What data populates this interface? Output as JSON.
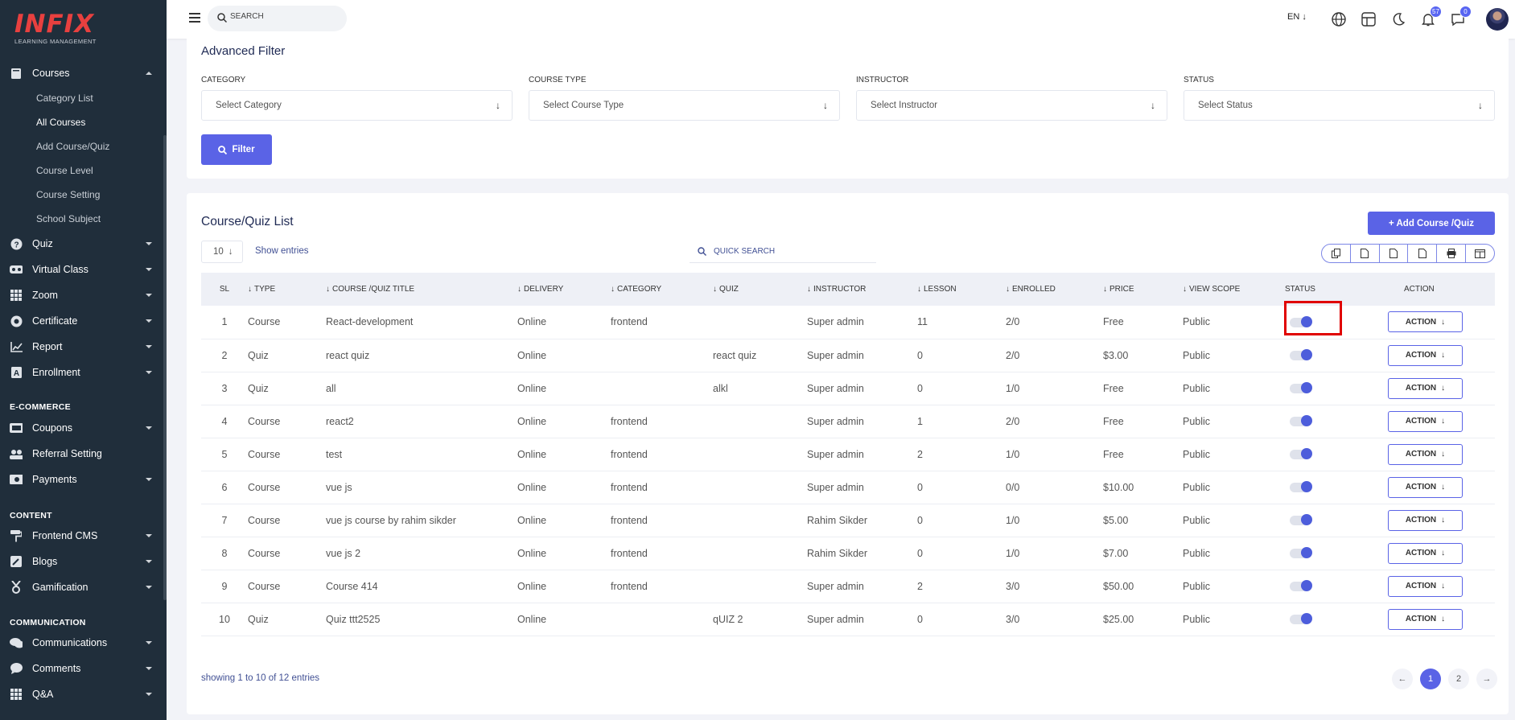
{
  "sidebar": {
    "logo": "INFIX",
    "logo_sub": "LEARNING MANAGEMENT",
    "courses": "Courses",
    "course_sub": [
      "Category List",
      "All Courses",
      "Add Course/Quiz",
      "Course Level",
      "Course Setting",
      "School Subject"
    ],
    "items1": [
      "Quiz",
      "Virtual Class",
      "Zoom",
      "Certificate",
      "Report",
      "Enrollment"
    ],
    "sec_ecom": "E-COMMERCE",
    "items2": [
      "Coupons",
      "Referral Setting",
      "Payments"
    ],
    "sec_content": "CONTENT",
    "items3": [
      "Frontend CMS",
      "Blogs",
      "Gamification"
    ],
    "sec_comm": "COMMUNICATION",
    "items4": [
      "Communications",
      "Comments",
      "Q&A"
    ]
  },
  "topbar": {
    "search_placeholder": "SEARCH",
    "lang": "EN",
    "notif_count": "57",
    "msg_count": "0"
  },
  "filter": {
    "title": "Advanced Filter",
    "fields": [
      {
        "label": "CATEGORY",
        "placeholder": "Select Category"
      },
      {
        "label": "COURSE TYPE",
        "placeholder": "Select Course Type"
      },
      {
        "label": "INSTRUCTOR",
        "placeholder": "Select Instructor"
      },
      {
        "label": "STATUS",
        "placeholder": "Select Status"
      }
    ],
    "button": "Filter"
  },
  "list": {
    "title": "Course/Quiz List",
    "add_button": "+ Add Course /Quiz",
    "per_page": "10",
    "show_entries": "Show entries",
    "quick_search": "QUICK SEARCH",
    "headers": [
      "SL",
      "TYPE",
      "COURSE /QUIZ TITLE",
      "DELIVERY",
      "CATEGORY",
      "QUIZ",
      "INSTRUCTOR",
      "LESSON",
      "ENROLLED",
      "PRICE",
      "VIEW SCOPE",
      "STATUS",
      "ACTION"
    ],
    "action_label": "ACTION",
    "rows": [
      [
        "1",
        "Course",
        "React-development",
        "Online",
        "frontend",
        "",
        "Super admin",
        "11",
        "2/0",
        "Free",
        "Public"
      ],
      [
        "2",
        "Quiz",
        "react quiz",
        "Online",
        "",
        "react quiz",
        "Super admin",
        "0",
        "2/0",
        "$3.00",
        "Public"
      ],
      [
        "3",
        "Quiz",
        "all",
        "Online",
        "",
        "alkl",
        "Super admin",
        "0",
        "1/0",
        "Free",
        "Public"
      ],
      [
        "4",
        "Course",
        "react2",
        "Online",
        "frontend",
        "",
        "Super admin",
        "1",
        "2/0",
        "Free",
        "Public"
      ],
      [
        "5",
        "Course",
        "test",
        "Online",
        "frontend",
        "",
        "Super admin",
        "2",
        "1/0",
        "Free",
        "Public"
      ],
      [
        "6",
        "Course",
        "vue js",
        "Online",
        "frontend",
        "",
        "Super admin",
        "0",
        "0/0",
        "$10.00",
        "Public"
      ],
      [
        "7",
        "Course",
        "vue js course by rahim sikder",
        "Online",
        "frontend",
        "",
        "Rahim Sikder",
        "0",
        "1/0",
        "$5.00",
        "Public"
      ],
      [
        "8",
        "Course",
        "vue js 2",
        "Online",
        "frontend",
        "",
        "Rahim Sikder",
        "0",
        "1/0",
        "$7.00",
        "Public"
      ],
      [
        "9",
        "Course",
        "Course 414",
        "Online",
        "frontend",
        "",
        "Super admin",
        "2",
        "3/0",
        "$50.00",
        "Public"
      ],
      [
        "10",
        "Quiz",
        "Quiz ttt2525",
        "Online",
        "",
        "qUIZ 2",
        "Super admin",
        "0",
        "3/0",
        "$25.00",
        "Public"
      ]
    ],
    "showing": "showing 1 to 10 of 12 entries",
    "pages": [
      "1",
      "2"
    ]
  },
  "colors": {
    "accent": "#5a63e6",
    "sidebar": "#202e3b",
    "highlight": "#e00000"
  }
}
